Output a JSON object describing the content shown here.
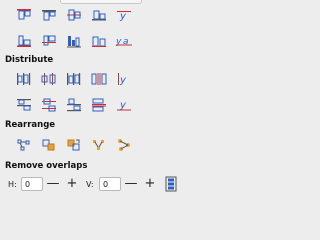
{
  "panel": {
    "sections": {
      "distribute": "Distribute",
      "rearrange": "Rearrange",
      "remove_overlaps": "Remove overlaps"
    },
    "remove_overlaps": {
      "h_label": "H:",
      "h_value": "0",
      "v_label": "V:",
      "v_value": "0",
      "minus_glyph": "—",
      "plus_glyph": "+"
    },
    "colors": {
      "background": "#ededed",
      "icon_blue": "#2f5fc4",
      "icon_red": "#c83232",
      "icon_orange": "#e6a23c"
    }
  }
}
